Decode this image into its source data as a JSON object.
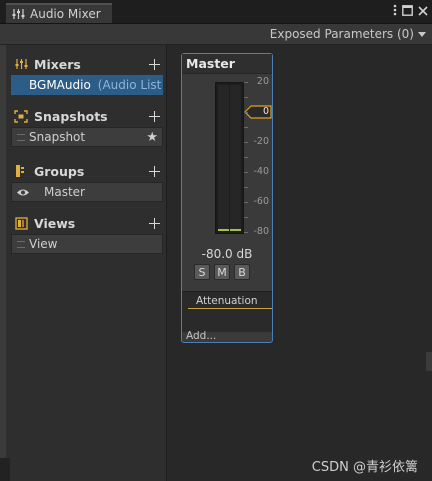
{
  "window": {
    "tab_title": "Audio Mixer",
    "menu_icon": "kebab-menu-icon",
    "maximize_icon": "maximize-icon",
    "close_icon": "close-icon"
  },
  "toolbar": {
    "exposed_parameters_label": "Exposed Parameters (0)"
  },
  "sidebar": {
    "mixers": {
      "title": "Mixers",
      "items": [
        {
          "name": "BGMAudio",
          "suffix": "(Audio Liste",
          "selected": true
        }
      ]
    },
    "snapshots": {
      "title": "Snapshots",
      "items": [
        {
          "name": "Snapshot",
          "starred": true
        }
      ]
    },
    "groups": {
      "title": "Groups",
      "items": [
        {
          "name": "Master",
          "visible": true
        }
      ]
    },
    "views": {
      "title": "Views",
      "items": [
        {
          "name": "View"
        }
      ]
    }
  },
  "strip": {
    "name": "Master",
    "scale_labels": [
      "20",
      "0",
      "-20",
      "-40",
      "-60",
      "-80"
    ],
    "fader_value": "0",
    "fader_level_db": 0,
    "meter_level_db": -80,
    "db_readout": "-80.0 dB",
    "solo_label": "S",
    "mute_label": "M",
    "bypass_label": "B",
    "effects": [
      "Attenuation"
    ],
    "add_label": "Add..."
  },
  "watermark": "CSDN @青衫依篱",
  "colors": {
    "selection": "#2c5d87",
    "strip_border": "#4a7fb8",
    "fader_handle": "#e0a020",
    "meter_peak": "#9ec24a",
    "attenuation_underline": "#c9a33b"
  }
}
